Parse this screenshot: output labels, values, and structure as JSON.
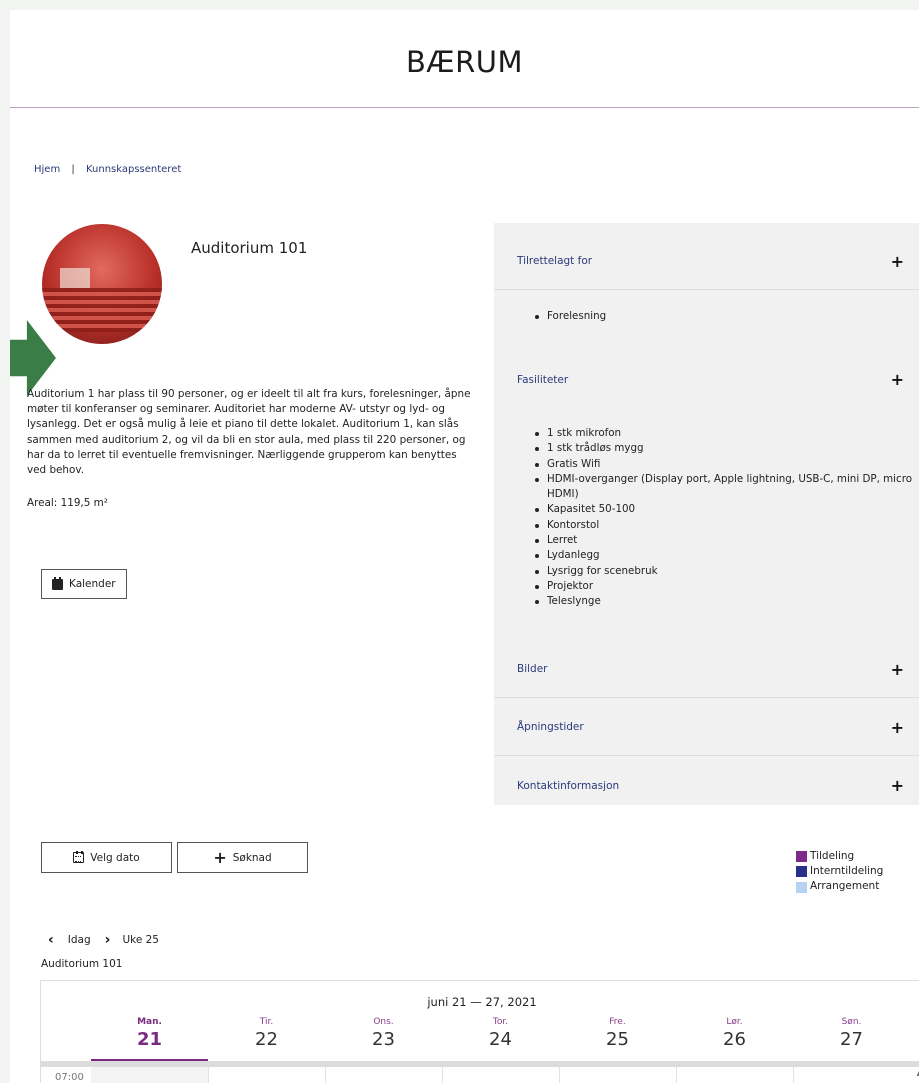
{
  "header": {
    "brand": "BÆRUM"
  },
  "breadcrumb": {
    "home": "Hjem",
    "separator": "|",
    "current": "Kunnskapssenteret"
  },
  "room": {
    "title": "Auditorium 101",
    "description": "Auditorium 1 har plass til 90 personer, og er ideelt til alt fra kurs, forelesninger, åpne møter til konferanser og seminarer. Auditoriet har moderne AV- utstyr og lyd- og lysanlegg. Det er også mulig å leie et piano til dette lokalet. Auditorium 1, kan slås sammen med auditorium 2, og vil da bli en stor aula, med plass til 220 personer, og har da to lerret til eventuelle fremvisninger. Nærliggende grupperom kan benyttes ved behov.",
    "area": "Areal: 119,5 m²",
    "calendar_button": "Kalender"
  },
  "accordion": {
    "sections": [
      {
        "label": "Tilrettelagt for",
        "toggle": "+",
        "items": [
          "Forelesning"
        ]
      },
      {
        "label": "Fasiliteter",
        "toggle": "+",
        "items": [
          "1 stk mikrofon",
          "1 stk trådløs mygg",
          "Gratis Wifi",
          "HDMI-overganger (Display port, Apple lightning, USB-C, mini DP, micro HDMI)",
          "Kapasitet 50-100",
          "Kontorstol",
          "Lerret",
          "Lydanlegg",
          "Lysrigg for scenebruk",
          "Projektor",
          "Teleslynge"
        ]
      },
      {
        "label": "Bilder",
        "toggle": "+"
      },
      {
        "label": "Åpningstider",
        "toggle": "+"
      },
      {
        "label": "Kontaktinformasjon",
        "toggle": "+"
      }
    ]
  },
  "actions": {
    "pick_date": "Velg dato",
    "apply": "Søknad",
    "apply_icon": "+"
  },
  "legend": [
    {
      "label": "Tildeling",
      "color": "#7b2a8a"
    },
    {
      "label": "Interntildeling",
      "color": "#262f8a"
    },
    {
      "label": "Arrangement",
      "color": "#b5d2f2"
    }
  ],
  "calendar": {
    "prev": "‹",
    "today": "Idag",
    "next": "›",
    "week": "Uke 25",
    "room_label": "Auditorium 101",
    "range": "juni 21 — 27, 2021",
    "days": [
      {
        "name": "Man.",
        "date": "21"
      },
      {
        "name": "Tir.",
        "date": "22"
      },
      {
        "name": "Ons.",
        "date": "23"
      },
      {
        "name": "Tor.",
        "date": "24"
      },
      {
        "name": "Fre.",
        "date": "25"
      },
      {
        "name": "Lør.",
        "date": "26"
      },
      {
        "name": "Søn.",
        "date": "27"
      }
    ],
    "first_time": "07:00",
    "scroll_up": "▲"
  },
  "colors": {
    "accent": "#7a2a80",
    "link": "#2b3a7a",
    "arrow": "#3b7d46",
    "panel": "#f1f1f1"
  }
}
